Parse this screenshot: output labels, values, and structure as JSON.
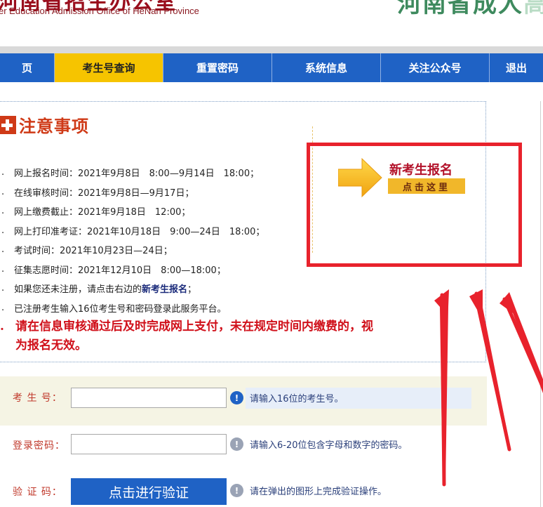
{
  "header": {
    "logo_cn": "河南省招生办公室",
    "logo_en": "er Education Admission Office of HeNan Province",
    "brand_right": "河南省成人",
    "brand_right_fade": "高"
  },
  "nav": {
    "tabs": [
      {
        "label": "页",
        "width": 78
      },
      {
        "label": "考生号查询",
        "width": 155
      },
      {
        "label": "重置密码",
        "width": 155
      },
      {
        "label": "系统信息",
        "width": 155
      },
      {
        "label": "关注公众号",
        "width": 155
      },
      {
        "label": "退出",
        "width": 76
      }
    ]
  },
  "notice": {
    "title": "注意事项",
    "items": [
      {
        "num": ".",
        "text": "网上报名时间：2021年9月8日　8:00—9月14日　18:00；"
      },
      {
        "num": ".",
        "text": "在线审核时间：2021年9月8日—9月17日；"
      },
      {
        "num": ".",
        "text": "网上缴费截止：2021年9月18日　12:00；"
      },
      {
        "num": ".",
        "text": "网上打印准考证：2021年10月18日　9:00—24日　18:00；"
      },
      {
        "num": ".",
        "text": "考试时间：2021年10月23日—24日；"
      },
      {
        "num": ".",
        "text": "征集志愿时间：2021年12月10日　8:00—18:00；"
      },
      {
        "num": ".",
        "text": "如果您还未注册，请点击右边的",
        "bold": "新考生报名",
        "tail": "；"
      },
      {
        "num": ".",
        "text": "已注册考生输入16位考生号和密码登录此服务平台。"
      }
    ],
    "warning_num": ".",
    "warning_line1": "请在信息审核通过后及时完成网上支付，未在规定时间内缴费的，视",
    "warning_line2": "为报名无效。"
  },
  "register": {
    "label": "新考生报名",
    "click": "点击这里"
  },
  "form": {
    "exam_no_label": "考 生 号：",
    "exam_no_value": "",
    "exam_no_hint": "请输入16位的考生号。",
    "password_label": "登录密码：",
    "password_value": "",
    "password_hint": "请输入6-20位包含字母和数字的密码。",
    "captcha_label": "验 证 码：",
    "captcha_button": "点击进行验证",
    "captcha_hint": "请在弹出的图形上完成验证操作。"
  },
  "colors": {
    "nav_blue": "#1f62c5",
    "nav_active": "#f6c400",
    "accent_red": "#e8222c",
    "title_red": "#cf3a17"
  }
}
